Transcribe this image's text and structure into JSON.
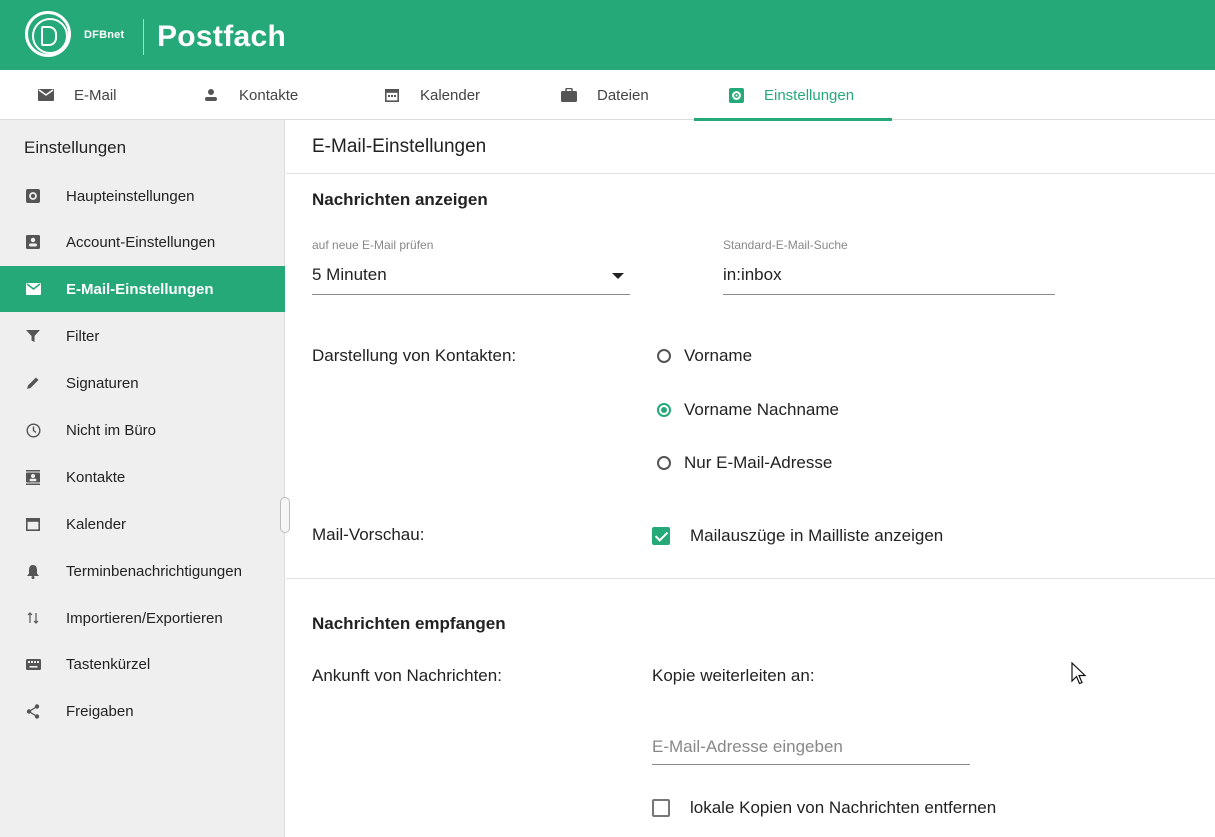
{
  "header": {
    "brand_sub": "DFBnet",
    "brand_title": "Postfach"
  },
  "tabs": [
    {
      "label": "E-Mail",
      "icon": "envelope-icon"
    },
    {
      "label": "Kontakte",
      "icon": "person-icon"
    },
    {
      "label": "Kalender",
      "icon": "calendar-icon"
    },
    {
      "label": "Dateien",
      "icon": "briefcase-icon"
    },
    {
      "label": "Einstellungen",
      "icon": "gear-icon",
      "active": true
    }
  ],
  "sidebar": {
    "heading": "Einstellungen",
    "items": [
      {
        "label": "Haupteinstellungen",
        "icon": "gear-icon"
      },
      {
        "label": "Account-Einstellungen",
        "icon": "account-icon"
      },
      {
        "label": "E-Mail-Einstellungen",
        "icon": "envelope-icon",
        "active": true
      },
      {
        "label": "Filter",
        "icon": "filter-icon"
      },
      {
        "label": "Signaturen",
        "icon": "pen-icon"
      },
      {
        "label": "Nicht im Büro",
        "icon": "clock-icon"
      },
      {
        "label": "Kontakte",
        "icon": "contacts-icon"
      },
      {
        "label": "Kalender",
        "icon": "calendar-icon"
      },
      {
        "label": "Terminbenachrichtigungen",
        "icon": "bell-icon"
      },
      {
        "label": "Importieren/Exportieren",
        "icon": "import-export-icon"
      },
      {
        "label": "Tastenkürzel",
        "icon": "keyboard-icon"
      },
      {
        "label": "Freigaben",
        "icon": "share-icon"
      }
    ]
  },
  "main": {
    "title": "E-Mail-Einstellungen",
    "section1": {
      "title": "Nachrichten anzeigen",
      "check_label": "auf neue E-Mail prüfen",
      "check_value": "5 Minuten",
      "search_label": "Standard-E-Mail-Suche",
      "search_value": "in:inbox",
      "contacts_label": "Darstellung von Kontakten:",
      "contact_options": [
        "Vorname",
        "Vorname Nachname",
        "Nur E-Mail-Adresse"
      ],
      "contact_selected": "Vorname Nachname",
      "preview_label": "Mail-Vorschau:",
      "preview_checkbox": "Mailauszüge in Mailliste anzeigen",
      "preview_checked": true
    },
    "section2": {
      "title": "Nachrichten empfangen",
      "arrival_label": "Ankunft von Nachrichten:",
      "forward_label": "Kopie weiterleiten an:",
      "forward_placeholder": "E-Mail-Adresse eingeben",
      "remove_local_label": "lokale Kopien von Nachrichten entfernen",
      "remove_local_checked": false
    }
  },
  "colors": {
    "accent": "#26a979",
    "sidebar_bg": "#efefef"
  }
}
